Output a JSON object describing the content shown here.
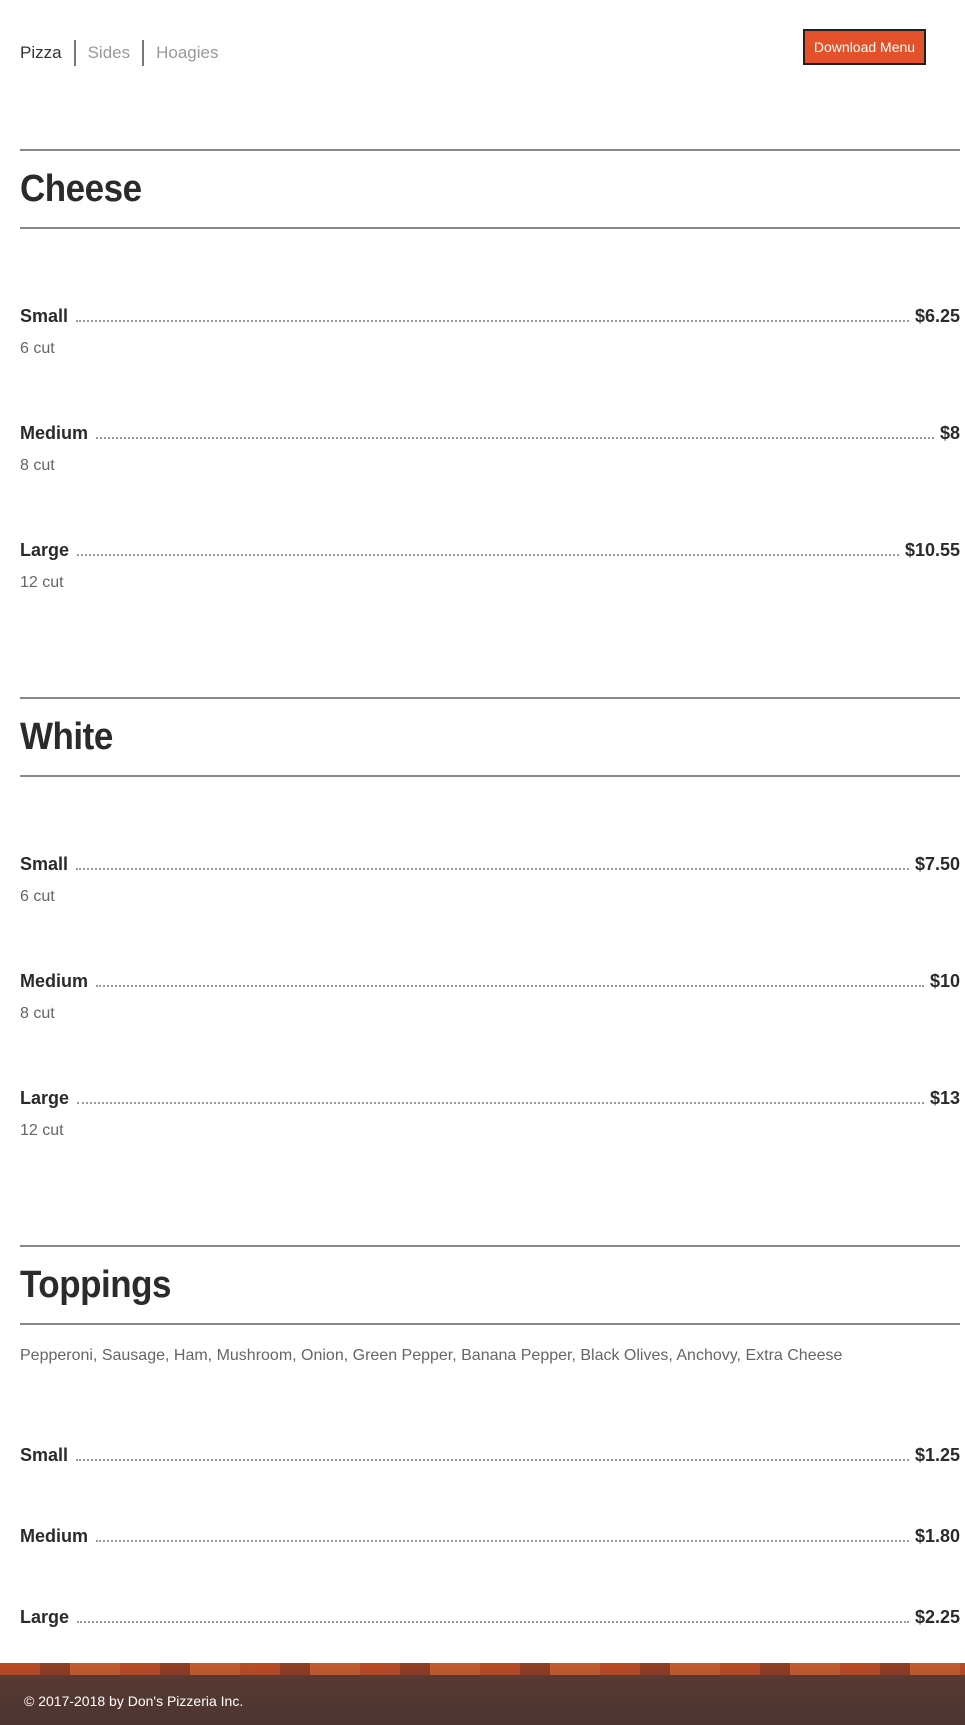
{
  "tabs": [
    {
      "label": "Pizza",
      "active": true
    },
    {
      "label": "Sides",
      "active": false
    },
    {
      "label": "Hoagies",
      "active": false
    }
  ],
  "download_button": {
    "label": "Download Menu",
    "color": "#e2512a"
  },
  "sections": [
    {
      "title": "Cheese",
      "items": [
        {
          "name": "Small",
          "price": "$6.25",
          "desc": "6 cut"
        },
        {
          "name": "Medium",
          "price": "$8",
          "desc": "8 cut"
        },
        {
          "name": "Large",
          "price": "$10.55",
          "desc": "12 cut"
        }
      ]
    },
    {
      "title": "White",
      "items": [
        {
          "name": "Small",
          "price": "$7.50",
          "desc": "6 cut"
        },
        {
          "name": "Medium",
          "price": "$10",
          "desc": "8 cut"
        },
        {
          "name": "Large",
          "price": "$13",
          "desc": "12 cut"
        }
      ]
    },
    {
      "title": "Toppings",
      "list": "Pepperoni, Sausage, Ham, Mushroom, Onion, Green Pepper, Banana Pepper, Black Olives, Anchovy, Extra Cheese",
      "items": [
        {
          "name": "Small",
          "price": "$1.25"
        },
        {
          "name": "Medium",
          "price": "$1.80"
        },
        {
          "name": "Large",
          "price": "$2.25"
        }
      ]
    }
  ],
  "footer": {
    "copyright": "© 2017-2018 by Don's Pizzeria Inc."
  }
}
